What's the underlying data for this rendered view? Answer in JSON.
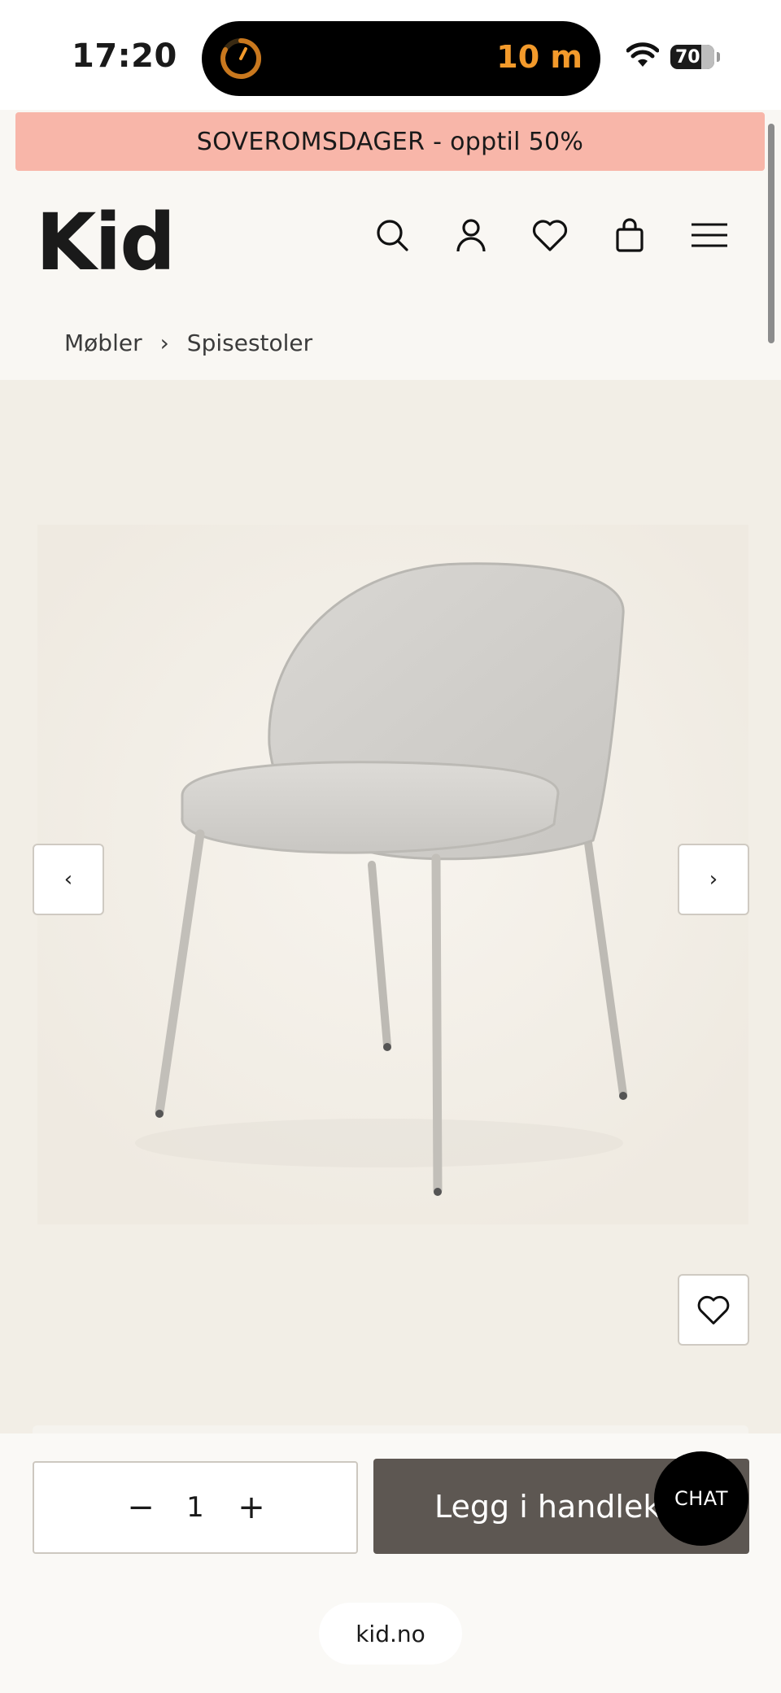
{
  "status_bar": {
    "time": "17:20",
    "activity_text": "10 m",
    "battery_level": "70"
  },
  "promo_banner": {
    "text": "SOVEROMSDAGER - opptil 50%"
  },
  "header": {
    "logo": "Kid",
    "icons": [
      "search-icon",
      "account-icon",
      "heart-icon",
      "bag-icon",
      "menu-icon"
    ]
  },
  "breadcrumb": {
    "items": [
      "Møbler",
      "Spisestoler"
    ],
    "separator": "›"
  },
  "gallery": {
    "prev_label": "‹",
    "next_label": "›"
  },
  "purchase": {
    "quantity": "1",
    "minus": "−",
    "plus": "+",
    "add_to_cart": "Legg i handlekurv",
    "chat_label": "CHAT"
  },
  "browser": {
    "url": "kid.no"
  },
  "colors": {
    "promo_bg": "#f8b6a9",
    "add_button": "#5d5752",
    "island_accent": "#f39a2b"
  }
}
